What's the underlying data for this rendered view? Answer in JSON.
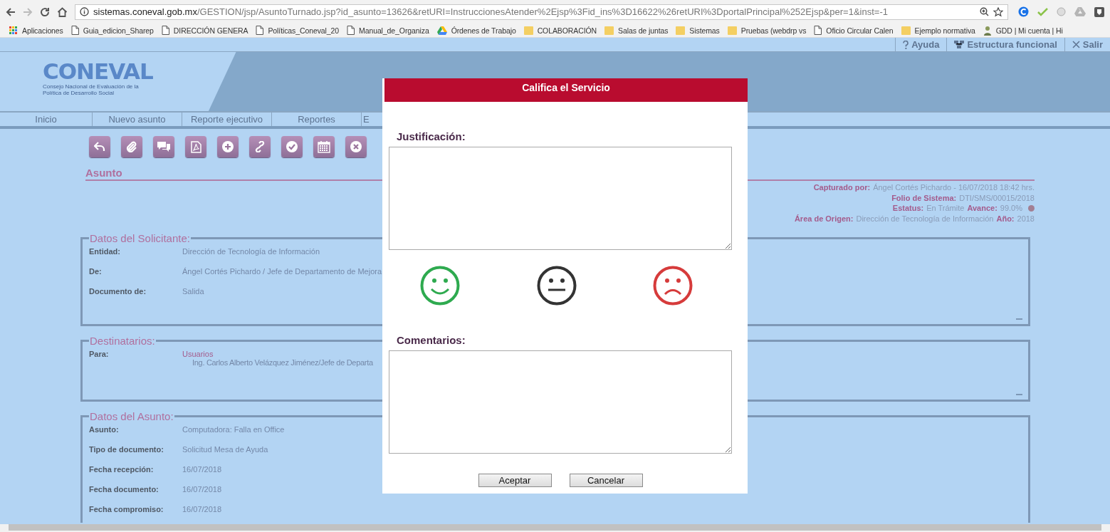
{
  "browser": {
    "url": {
      "host": "sistemas.coneval.gob.mx",
      "path": "/GESTION/jsp/AsuntoTurnado.jsp?id_asunto=13626&retURI=InstruccionesAtender%2Ejsp%3Fid_ins%3D16622%26retURI%3DportalPrincipal%252Ejsp&per=1&inst=-1"
    },
    "bookmarks": [
      {
        "label": "Aplicaciones",
        "kind": "apps"
      },
      {
        "label": "Guia_edicion_Sharep",
        "kind": "page"
      },
      {
        "label": "DIRECCIÓN GENERA",
        "kind": "page"
      },
      {
        "label": "Políticas_Coneval_20",
        "kind": "page"
      },
      {
        "label": "Manual_de_Organiza",
        "kind": "page"
      },
      {
        "label": "Órdenes de Trabajo",
        "kind": "drive"
      },
      {
        "label": "COLABORACIÓN",
        "kind": "folder"
      },
      {
        "label": "Salas de juntas",
        "kind": "folder"
      },
      {
        "label": "Sistemas",
        "kind": "folder"
      },
      {
        "label": "Pruebas (webdrp vs",
        "kind": "folder"
      },
      {
        "label": "Oficio Circular Calen",
        "kind": "page"
      },
      {
        "label": "Ejemplo normativa",
        "kind": "folder"
      },
      {
        "label": "GDD | Mi cuenta | Hi",
        "kind": "figure"
      }
    ]
  },
  "top_links": [
    {
      "label": "Ayuda",
      "kind": "help"
    },
    {
      "label": "Estructura funcional",
      "kind": "structure"
    },
    {
      "label": "Salir",
      "kind": "exit"
    }
  ],
  "logo": {
    "name": "CONEVAL",
    "tagline": "Consejo Nacional de Evaluación de la Política de Desarrollo Social"
  },
  "nav": [
    "Inicio",
    "Nuevo asunto",
    "Reporte ejecutivo",
    "Reportes",
    "E"
  ],
  "toolbar": [
    {
      "kind": "reply"
    },
    {
      "kind": "attach"
    },
    {
      "kind": "chat"
    },
    {
      "kind": "pdf"
    },
    {
      "kind": "add"
    },
    {
      "kind": "link"
    },
    {
      "kind": "check"
    },
    {
      "kind": "calendar"
    },
    {
      "kind": "cancel"
    }
  ],
  "section_title": "Asunto",
  "meta": [
    {
      "pairs": [
        {
          "label": "Capturado por:",
          "value": "Ángel Cortés Pichardo - 16/07/2018 18:42 hrs."
        }
      ],
      "indicator": false
    },
    {
      "pairs": [
        {
          "label": "Folio de Sistema:",
          "value": "DTI/SMS/00015/2018"
        }
      ],
      "indicator": false
    },
    {
      "pairs": [
        {
          "label": "Estatus:",
          "value": "En Trámite"
        },
        {
          "label": "Avance:",
          "value": "99.0%"
        }
      ],
      "indicator": true
    },
    {
      "pairs": [
        {
          "label": "Área de Origen:",
          "value": "Dirección de Tecnología de Información"
        },
        {
          "label": "Año:",
          "value": "2018"
        }
      ],
      "indicator": false
    }
  ],
  "fieldsets": [
    {
      "title": "Datos del Solicitante:",
      "rows": [
        {
          "label": "Entidad:",
          "value": "Dirección de Tecnología de Información"
        },
        {
          "label": "De:",
          "value": "Ángel Cortés Pichardo / Jefe de Departamento de Mejora"
        },
        {
          "label": "Documento de:",
          "value": "Salida"
        }
      ]
    },
    {
      "title": "Destinatarios:",
      "rows": [
        {
          "label": "Para:",
          "group": "Usuarios",
          "members": [
            "Ing. Carlos Alberto Velázquez Jiménez/Jefe de Departa"
          ]
        }
      ]
    },
    {
      "title": "Datos del Asunto:",
      "rows": [
        {
          "label": "Asunto:",
          "value": "Computadora: Falla en Office"
        },
        {
          "label": "Tipo de documento:",
          "value": "Solicitud Mesa de Ayuda"
        },
        {
          "label": "Fecha recepción:",
          "value": "16/07/2018"
        },
        {
          "label": "Fecha documento:",
          "value": "16/07/2018"
        },
        {
          "label": "Fecha compromiso:",
          "value": "16/07/2018"
        }
      ]
    }
  ],
  "dialog": {
    "title": "Califica el Servicio",
    "justification": {
      "label": "Justificación:"
    },
    "ratings": [
      {
        "kind": "happy"
      },
      {
        "kind": "neutral"
      },
      {
        "kind": "sad"
      }
    ],
    "comments": {
      "label": "Comentarios:"
    },
    "buttons": [
      "Aceptar",
      "Cancelar"
    ]
  }
}
